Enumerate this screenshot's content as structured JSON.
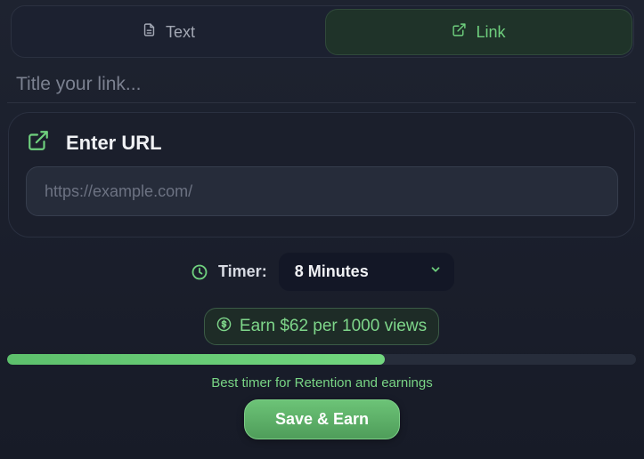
{
  "tabs": [
    {
      "label": "Text",
      "icon": "document-icon",
      "active": false
    },
    {
      "label": "Link",
      "icon": "external-link-icon",
      "active": true
    }
  ],
  "title_input": {
    "placeholder": "Title your link...",
    "value": ""
  },
  "url_card": {
    "title": "Enter URL",
    "icon": "external-link-icon",
    "input_placeholder": "https://example.com/",
    "input_value": ""
  },
  "timer": {
    "label": "Timer:",
    "icon": "clock-icon",
    "selected": "8 Minutes"
  },
  "earn_badge": {
    "text": "Earn $62 per 1000 views",
    "icon": "dollar-icon"
  },
  "progress": {
    "fraction": 0.6
  },
  "hint": "Best timer for Retention and earnings",
  "save_button": {
    "label": "Save & Earn"
  },
  "colors": {
    "accent_green": "#6fd07e",
    "background": "#1c2130",
    "button_green": "#5aaf66"
  }
}
